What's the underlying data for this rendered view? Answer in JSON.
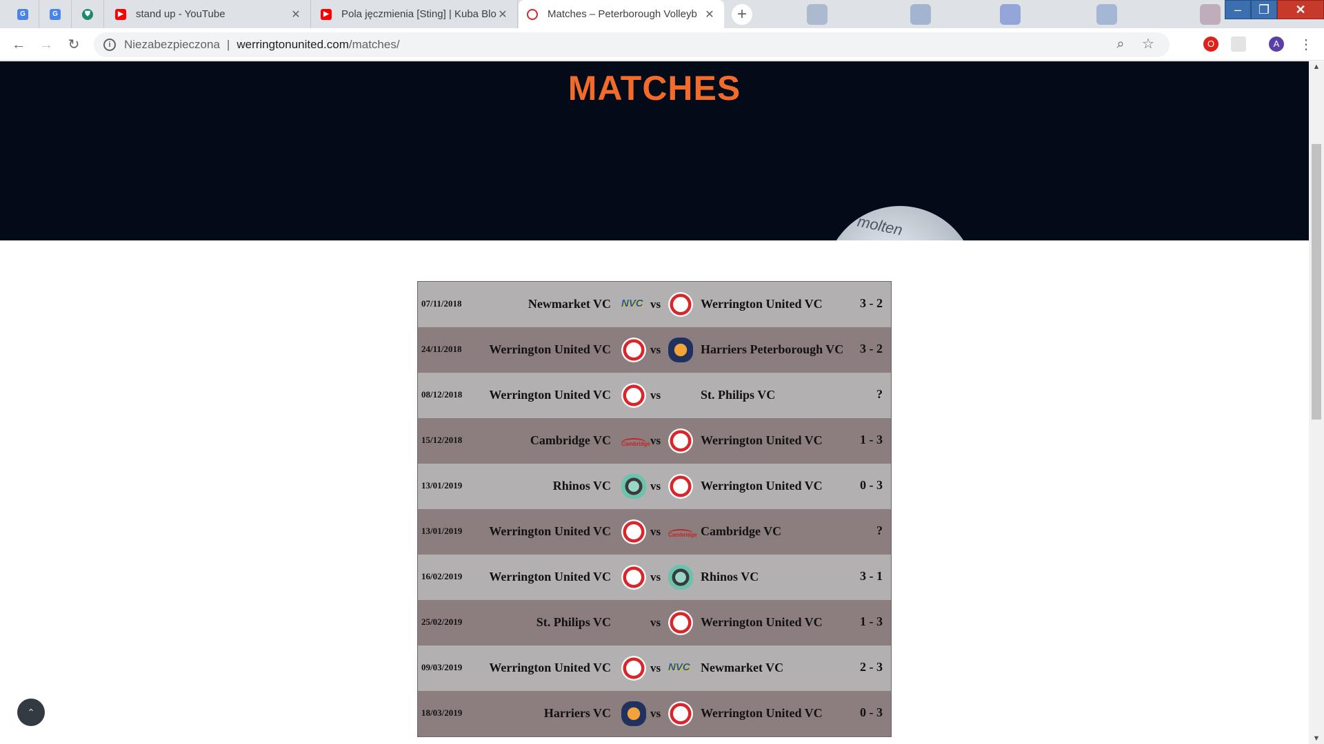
{
  "browser": {
    "tabs": [
      {
        "title": "",
        "favicon": "google-translate-icon",
        "pinned": true
      },
      {
        "title": "",
        "favicon": "google-translate-icon",
        "pinned": true
      },
      {
        "title": "",
        "favicon": "shield-extension-icon",
        "pinned": true
      },
      {
        "title": "stand up - YouTube",
        "favicon": "youtube-icon"
      },
      {
        "title": "Pola jęczmienia [Sting] | Kuba Blo",
        "favicon": "youtube-icon"
      },
      {
        "title": "Matches – Peterborough Volleyb",
        "favicon": "volleyball-icon",
        "active": true
      }
    ],
    "address": {
      "security_label": "Niezabezpieczona",
      "host": "werringtonunited.com",
      "path": "/matches/"
    },
    "profile_initial": "A"
  },
  "page": {
    "title": "MATCHES",
    "ball_text": "molten",
    "accent_color": "#f26b2a",
    "vs_label": "vs"
  },
  "matches": [
    {
      "date": "07/11/2018",
      "home": "Newmarket VC",
      "home_logo": "nvc",
      "away": "Werrington United VC",
      "away_logo": "wu",
      "score": "3 - 2"
    },
    {
      "date": "24/11/2018",
      "home": "Werrington United VC",
      "home_logo": "wu",
      "away": "Harriers Peterborough VC",
      "away_logo": "har",
      "score": "3 - 2"
    },
    {
      "date": "08/12/2018",
      "home": "Werrington United VC",
      "home_logo": "wu",
      "away": "St. Philips VC",
      "away_logo": "",
      "score": "?"
    },
    {
      "date": "15/12/2018",
      "home": "Cambridge VC",
      "home_logo": "cam",
      "away": "Werrington United VC",
      "away_logo": "wu",
      "score": "1 - 3"
    },
    {
      "date": "13/01/2019",
      "home": "Rhinos VC",
      "home_logo": "rhi",
      "away": "Werrington United VC",
      "away_logo": "wu",
      "score": "0 - 3"
    },
    {
      "date": "13/01/2019",
      "home": "Werrington United VC",
      "home_logo": "wu",
      "away": "Cambridge VC",
      "away_logo": "cam",
      "score": "?"
    },
    {
      "date": "16/02/2019",
      "home": "Werrington United VC",
      "home_logo": "wu",
      "away": "Rhinos VC",
      "away_logo": "rhi",
      "score": "3 - 1"
    },
    {
      "date": "25/02/2019",
      "home": "St. Philips VC",
      "home_logo": "",
      "away": "Werrington United VC",
      "away_logo": "wu",
      "score": "1 - 3"
    },
    {
      "date": "09/03/2019",
      "home": "Werrington United VC",
      "home_logo": "wu",
      "away": "Newmarket VC",
      "away_logo": "nvc",
      "score": "2 - 3"
    },
    {
      "date": "18/03/2019",
      "home": "Harriers VC",
      "home_logo": "har",
      "away": "Werrington United VC",
      "away_logo": "wu",
      "score": "0 - 3"
    }
  ]
}
